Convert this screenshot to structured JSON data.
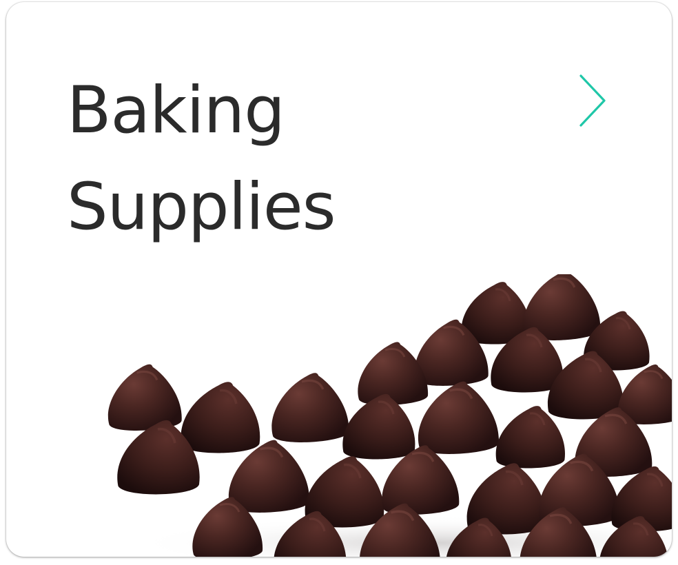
{
  "card": {
    "title_line1": "Baking",
    "title_line2": "Supplies",
    "chevron_icon": "chevron-right-icon",
    "image": "chocolate-chips-photo"
  },
  "colors": {
    "title": "#2b2b2b",
    "accent": "#1fc7a8",
    "chip_dark": "#2e1616",
    "chip_mid": "#4a2622",
    "chip_light": "#6b3b35"
  }
}
